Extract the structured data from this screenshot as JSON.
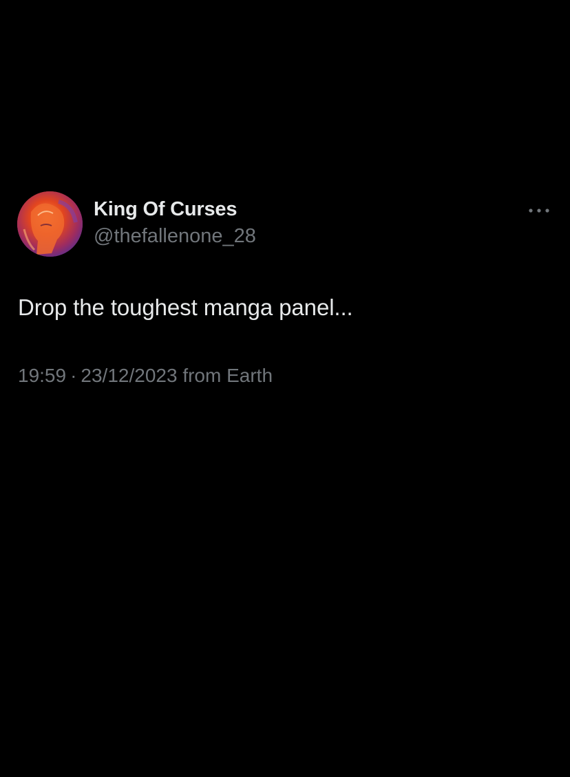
{
  "tweet": {
    "author": {
      "display_name": "King Of Curses",
      "handle": "@thefallenone_28",
      "avatar_icon": "profile-avatar-image"
    },
    "more_icon": "more-horizontal-icon",
    "text": "Drop the toughest manga panel...",
    "meta": {
      "time": "19:59",
      "separator": "·",
      "date": "23/12/2023",
      "source": "from Earth"
    }
  },
  "colors": {
    "background": "#000000",
    "primary_text": "#e7e9ea",
    "secondary_text": "#71767b"
  }
}
